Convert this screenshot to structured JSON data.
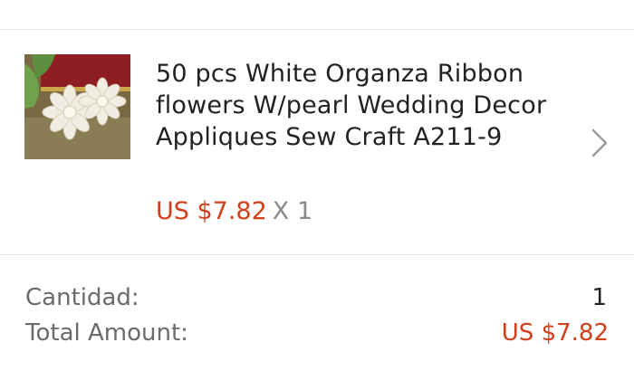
{
  "item": {
    "title_line1": "50 pcs White Organza Ribbon",
    "title_line2": "flowers W/pearl Wedding Decor",
    "title_line3": "Appliques Sew Craft A211-9",
    "price": "US $7.82",
    "quantity": "X 1",
    "thumbnail_icon": "product-thumbnail",
    "chevron_icon": "chevron-right-icon"
  },
  "summary": {
    "quantity_label": "Cantidad:",
    "quantity_value": "1",
    "total_label": "Total Amount:",
    "total_value": "US $7.82"
  },
  "colors": {
    "price": "#d23f1c",
    "text": "#222222",
    "muted": "#6b6b6b",
    "divider": "#e6e6e6"
  }
}
